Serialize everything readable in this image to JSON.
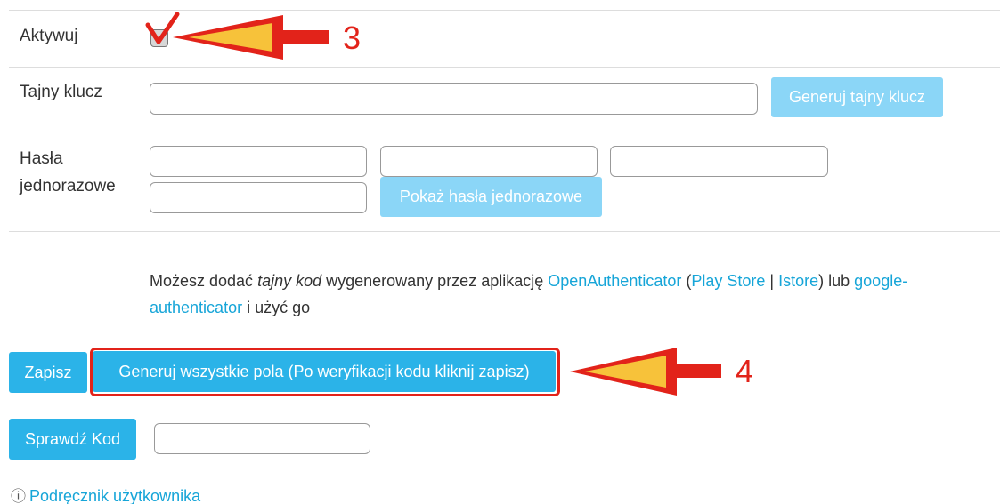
{
  "form": {
    "activate": {
      "label": "Aktywuj",
      "checked": true
    },
    "secret_key": {
      "label": "Tajny klucz",
      "value": "",
      "generate_button": "Generuj tajny klucz"
    },
    "one_time_passwords": {
      "label_line1": "Hasła",
      "label_line2": "jednorazowe",
      "fields": [
        "",
        "",
        "",
        ""
      ],
      "show_button": "Pokaż hasła jednorazowe"
    },
    "info": {
      "part1": "Możesz dodać ",
      "secret_code": "tajny kod",
      "part2": " wygenerowany przez aplikację ",
      "open_authenticator": "OpenAuthenticator",
      "part3": " (",
      "play_store": "Play Store",
      "separator": " | ",
      "istore": "Istore",
      "part4": ") lub ",
      "google_auth_1": "google-",
      "google_auth_2": "authenticator",
      "part5": " i użyć go"
    },
    "save_button": "Zapisz",
    "generate_all_button": "Generuj wszystkie pola (Po weryfikacji kodu kliknij zapisz)",
    "check_code_button": "Sprawdź Kod",
    "check_code_value": ""
  },
  "annotations": {
    "step3": "3",
    "step4": "4",
    "color": "#e2231a",
    "arrow_fill": "#f7c23a"
  },
  "footer": {
    "info_icon": "info-circle-icon",
    "manual_link": "Podręcznik użytkownika"
  },
  "colors": {
    "primary_button": "#2bb3e8",
    "light_button": "#8bd6f7",
    "link": "#16a5d8"
  }
}
